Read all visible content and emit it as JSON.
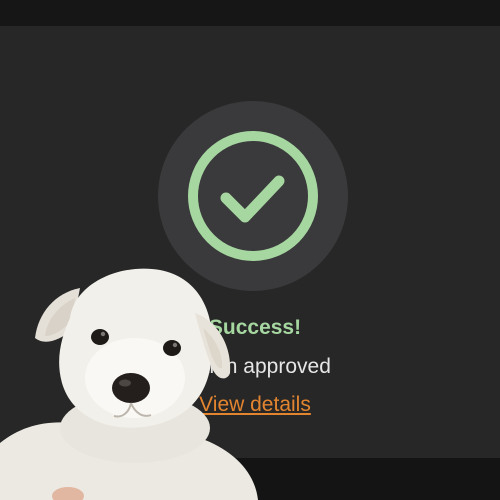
{
  "dialog": {
    "title": "Success!",
    "message": "Action approved",
    "link_label": "View details"
  },
  "icons": {
    "status": "checkmark-circle-icon"
  },
  "colors": {
    "background": "#171717",
    "panel": "#272727",
    "icon_circle": "#3a3a3c",
    "success_green": "#a6d7a0",
    "link_orange": "#e3852f",
    "text": "#e6e6e6"
  },
  "overlay": {
    "type": "puppy-photo"
  }
}
